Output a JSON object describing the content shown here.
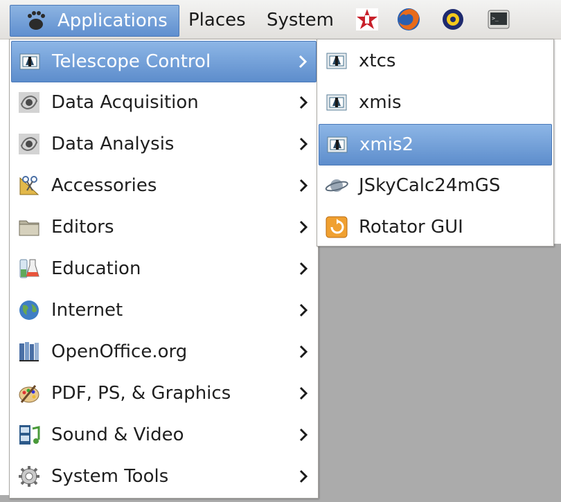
{
  "panel": {
    "applications_label": "Applications",
    "places_label": "Places",
    "system_label": "System",
    "launchers": [
      "app-logo-icon",
      "firefox-icon",
      "astro-clock-icon",
      "terminal-icon"
    ]
  },
  "main_menu": {
    "items": [
      {
        "label": "Telescope Control",
        "icon": "telescope-app-icon",
        "selected": true
      },
      {
        "label": "Data Acquisition",
        "icon": "galaxy-icon"
      },
      {
        "label": "Data Analysis",
        "icon": "galaxy-icon"
      },
      {
        "label": "Accessories",
        "icon": "scissors-ruler-icon"
      },
      {
        "label": "Editors",
        "icon": "folder-icon"
      },
      {
        "label": "Education",
        "icon": "flask-icon"
      },
      {
        "label": "Internet",
        "icon": "globe-icon"
      },
      {
        "label": "OpenOffice.org",
        "icon": "books-icon"
      },
      {
        "label": "PDF, PS, & Graphics",
        "icon": "palette-icon"
      },
      {
        "label": "Sound & Video",
        "icon": "film-music-icon"
      },
      {
        "label": "System Tools",
        "icon": "gear-icon"
      }
    ]
  },
  "sub_menu": {
    "items": [
      {
        "label": "xtcs",
        "icon": "telescope-app-icon"
      },
      {
        "label": "xmis",
        "icon": "telescope-app-icon"
      },
      {
        "label": "xmis2",
        "icon": "telescope-app-icon",
        "selected": true
      },
      {
        "label": "JSkyCalc24mGS",
        "icon": "planet-icon"
      },
      {
        "label": "Rotator GUI",
        "icon": "rotator-icon"
      }
    ]
  },
  "colors": {
    "selection": "#6a97d3",
    "desktop": "#ababab"
  }
}
